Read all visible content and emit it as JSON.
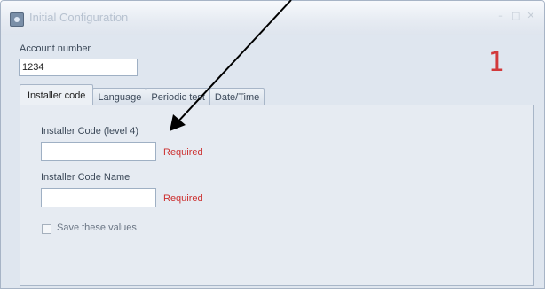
{
  "window": {
    "title": "Initial Configuration",
    "controls": {
      "minimize": "–",
      "maximize": "□",
      "close": "✕"
    }
  },
  "account": {
    "label": "Account number",
    "value": "1234"
  },
  "annotation": {
    "number": "1",
    "color": "#d2393b"
  },
  "tabs": [
    {
      "label": "Installer code",
      "active": true
    },
    {
      "label": "Language",
      "active": false
    },
    {
      "label": "Periodic test",
      "active": false
    },
    {
      "label": "Date/Time",
      "active": false
    }
  ],
  "installer_code": {
    "code_label": "Installer Code (level 4)",
    "code_value": "",
    "code_required": "Required",
    "name_label": "Installer Code Name",
    "name_value": "",
    "name_required": "Required",
    "save_label": "Save these values",
    "save_checked": false
  },
  "colors": {
    "required": "#cc2f2f",
    "window_bg": "#dfe6ef"
  }
}
